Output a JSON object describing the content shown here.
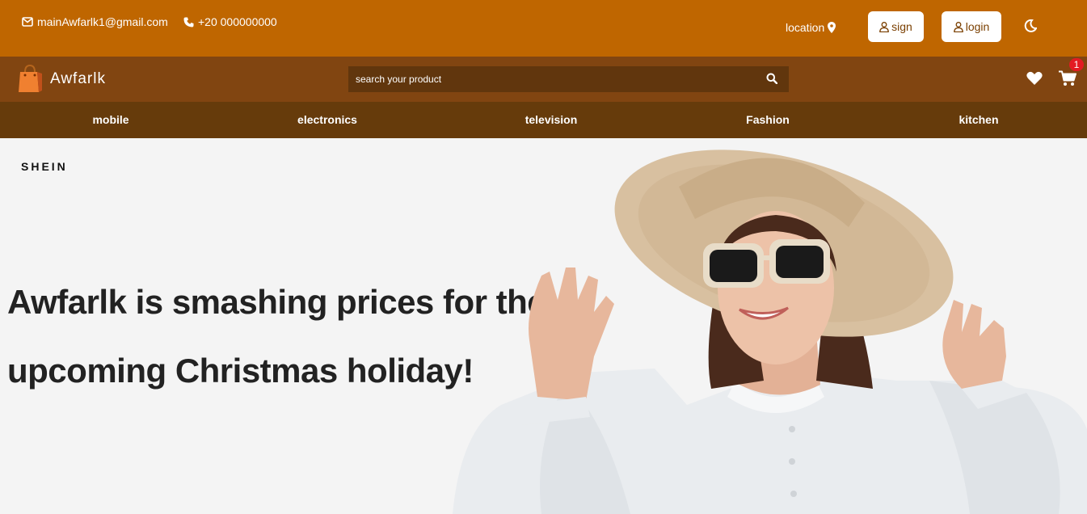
{
  "topbar": {
    "email": "mainAwfarlk1@gmail.com",
    "phone": "+20 000000000",
    "location": "location",
    "sign_label": "sign",
    "login_label": "login"
  },
  "header": {
    "brand": "Awfarlk",
    "search_placeholder": "search your product",
    "cart_count": "1"
  },
  "nav": {
    "items": [
      "mobile",
      "electronics",
      "television",
      "Fashion",
      "kitchen"
    ]
  },
  "hero": {
    "brand_logo": "SHEIN",
    "headline": "Awfarlk is smashing prices for the upcoming Christmas holiday!"
  },
  "colors": {
    "topbar": "#bf6600",
    "header": "#814511",
    "nav": "#663b0b",
    "search": "#61360d",
    "badge": "#e31b23"
  }
}
